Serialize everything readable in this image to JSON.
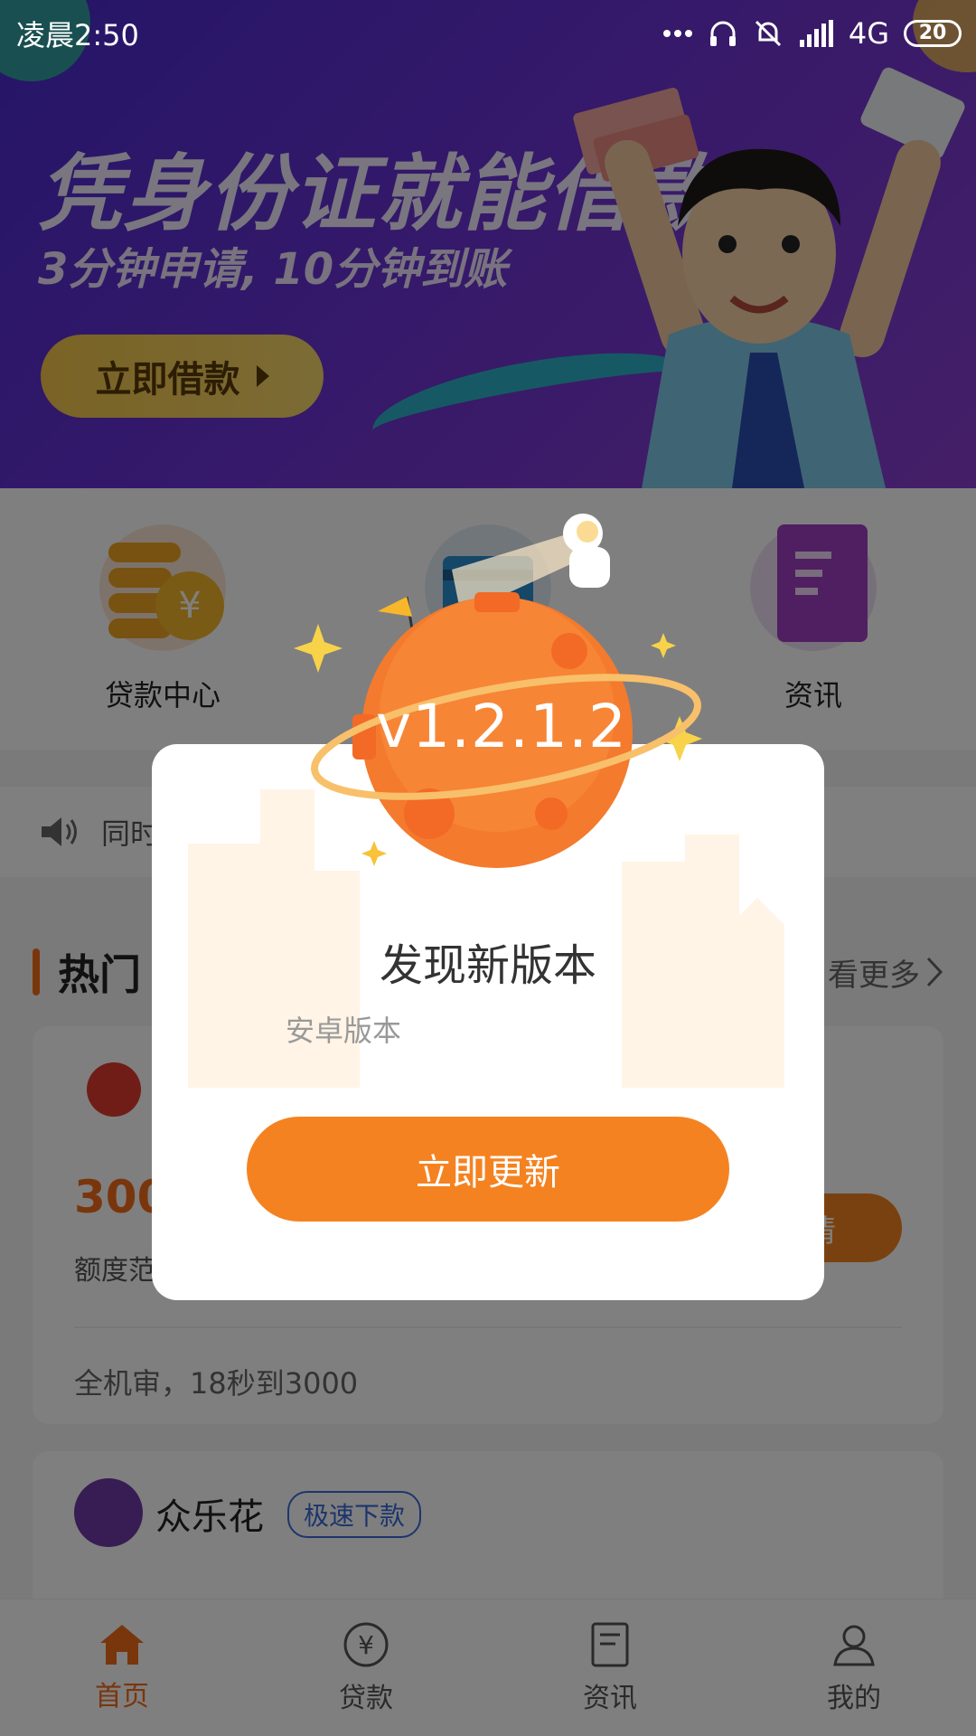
{
  "status_bar": {
    "time": "凌晨2:50",
    "network": "4G",
    "battery": "20"
  },
  "banner": {
    "title": "凭身份证就能借款",
    "subtitle": "3分钟申请, 10分钟到账",
    "button": "立即借款"
  },
  "categories": [
    {
      "label": "贷款中心",
      "icon": "coin-stack-icon"
    },
    {
      "label": "",
      "icon": "credit-card-icon"
    },
    {
      "label": "资讯",
      "icon": "document-icon"
    }
  ],
  "notice": {
    "text": "同时"
  },
  "hot_section": {
    "title": "热门",
    "see_more": "看更多"
  },
  "card1": {
    "amount": "300",
    "range": "额度范",
    "apply": "请",
    "desc": "全机审，18秒到3000"
  },
  "card2": {
    "name": "众乐花",
    "tag": "极速下款"
  },
  "dialog": {
    "version": "v1.2.1.2",
    "title": "发现新版本",
    "subtitle": "安卓版本",
    "button": "立即更新"
  },
  "tabs": [
    {
      "label": "首页",
      "icon": "home-icon",
      "active": true
    },
    {
      "label": "贷款",
      "icon": "yuan-icon",
      "active": false
    },
    {
      "label": "资讯",
      "icon": "news-icon",
      "active": false
    },
    {
      "label": "我的",
      "icon": "user-icon",
      "active": false
    }
  ],
  "colors": {
    "accent": "#F58220",
    "banner": "#5B2ED1",
    "tag_blue": "#3A6BD8"
  }
}
